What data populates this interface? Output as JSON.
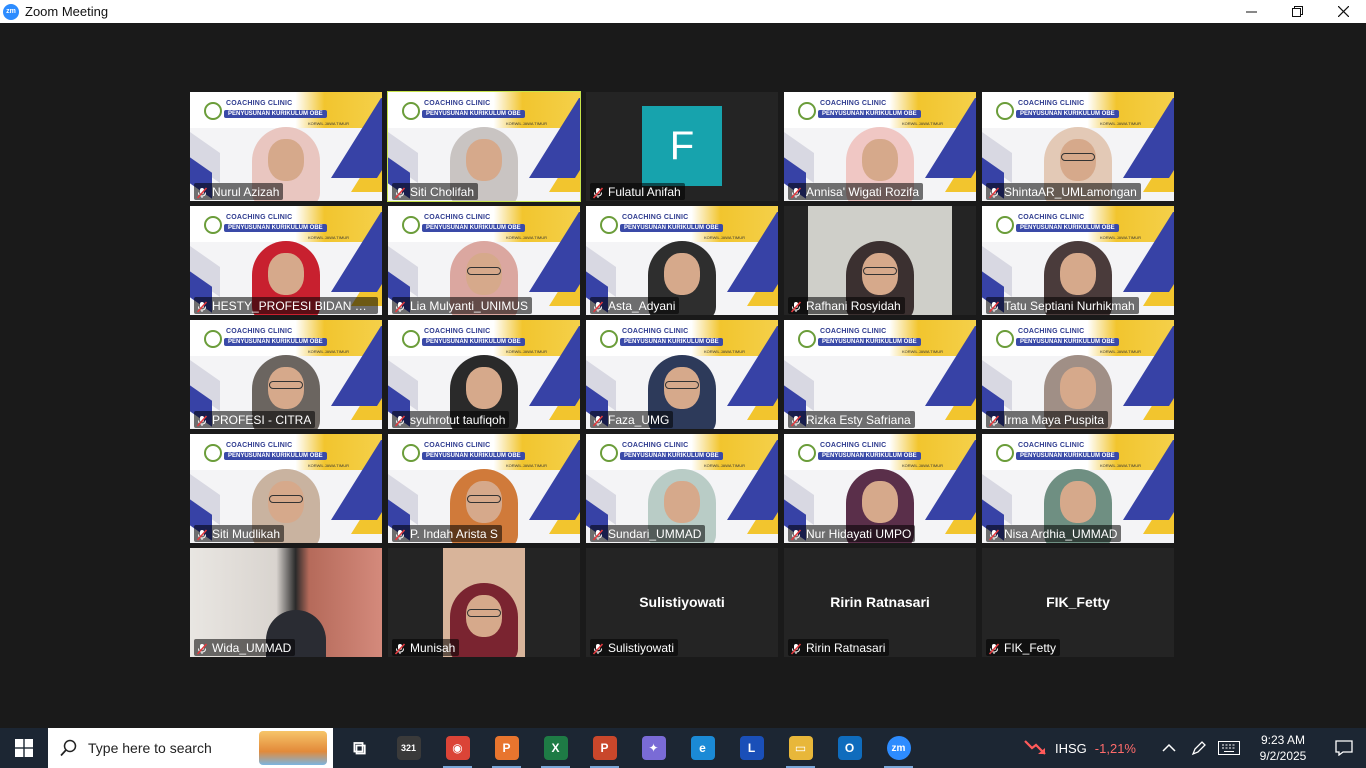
{
  "window": {
    "title": "Zoom Meeting",
    "logo_text": "zm"
  },
  "banner": {
    "title": "COACHING CLINIC",
    "subtitle": "PENYUSUNAN KURIKULUM OBE",
    "region": "KORWIL JAWA TIMUR"
  },
  "participants": [
    {
      "name": "Nurul Azizah",
      "kind": "vbg",
      "hijab": "#e9c6c0",
      "glasses": false
    },
    {
      "name": "Siti Cholifah",
      "kind": "vbg",
      "hijab": "#c9c4c2",
      "glasses": false,
      "speaking": true
    },
    {
      "name": "Fulatul Anifah",
      "kind": "avatar",
      "initial": "F"
    },
    {
      "name": "Annisa' Wigati Rozifa",
      "kind": "vbg",
      "hijab": "#f0c7c4",
      "glasses": false
    },
    {
      "name": "ShintaAR_UMLamongan",
      "kind": "vbg",
      "hijab": "#e3c9b6",
      "glasses": true
    },
    {
      "name": "HESTY_PROFESI BIDAN UM...",
      "kind": "vbg",
      "hijab": "#c8202f",
      "glasses": false
    },
    {
      "name": "Lia Mulyanti_UNIMUS",
      "kind": "vbg",
      "hijab": "#dba7a0",
      "glasses": true
    },
    {
      "name": "Asta_Adyani",
      "kind": "vbg",
      "hijab": "#2e2e2e",
      "glasses": false
    },
    {
      "name": "Rafhani Rosyidah",
      "kind": "photo",
      "bg": "#cfcfc9",
      "hijab": "#3b3030",
      "glasses": true
    },
    {
      "name": "Tatu Septiani Nurhikmah",
      "kind": "vbg",
      "hijab": "#4a3b3b",
      "glasses": false
    },
    {
      "name": "PROFESI - CITRA",
      "kind": "vbg",
      "hijab": "#6b6560",
      "glasses": true
    },
    {
      "name": "syuhrotut taufiqoh",
      "kind": "vbg",
      "hijab": "#2a2a2a",
      "glasses": false
    },
    {
      "name": "Faza_UMG",
      "kind": "vbg",
      "hijab": "#2d3a5a",
      "glasses": true
    },
    {
      "name": "Rizka Esty Safriana",
      "kind": "vbg",
      "hijab": "",
      "glasses": false,
      "empty": true
    },
    {
      "name": "Irma Maya Puspita",
      "kind": "vbg",
      "hijab": "#a08f86",
      "glasses": false
    },
    {
      "name": "Siti Mudlikah",
      "kind": "vbg",
      "hijab": "#c9b3a0",
      "glasses": true
    },
    {
      "name": "P. Indah Arista S",
      "kind": "vbg",
      "hijab": "#d07a3a",
      "glasses": true
    },
    {
      "name": "Sundari_UMMAD",
      "kind": "vbg",
      "hijab": "#b9ccc6",
      "glasses": false
    },
    {
      "name": "Nur Hidayati UMPO",
      "kind": "vbg",
      "hijab": "#5a2f4a",
      "glasses": false
    },
    {
      "name": "Nisa Ardhia_UMMAD",
      "kind": "vbg",
      "hijab": "#6f8f82",
      "glasses": false
    },
    {
      "name": "Wida_UMMAD",
      "kind": "room"
    },
    {
      "name": "Munisah",
      "kind": "portrait",
      "hijab": "#7a2430",
      "glasses": true
    },
    {
      "name": "Sulistiyowati",
      "kind": "name",
      "display": "Sulistiyowati"
    },
    {
      "name": "Ririn Ratnasari",
      "kind": "name",
      "display": "Ririn Ratnasari"
    },
    {
      "name": "FIK_Fetty",
      "kind": "name",
      "display": "FIK_Fetty"
    }
  ],
  "taskbar": {
    "search_placeholder": "Type here to search",
    "apps": [
      {
        "icon": "task-view-icon",
        "color": "transparent",
        "glyph": "⧉"
      },
      {
        "icon": "calendar-app-icon",
        "color": "#3a3a3a",
        "glyph": "321"
      },
      {
        "icon": "chrome-icon",
        "color": "#db4437",
        "glyph": "◉",
        "active": true
      },
      {
        "icon": "pdf-app-icon",
        "color": "#e8752e",
        "glyph": "P",
        "active": true
      },
      {
        "icon": "excel-icon",
        "color": "#1e7b45",
        "glyph": "X",
        "active": true
      },
      {
        "icon": "powerpoint-icon",
        "color": "#c9472b",
        "glyph": "P",
        "active": true
      },
      {
        "icon": "copilot-icon",
        "color": "#7a6bd6",
        "glyph": "✦"
      },
      {
        "icon": "edge-icon",
        "color": "#1b8ad6",
        "glyph": "e"
      },
      {
        "icon": "l-app-icon",
        "color": "#1a4fb8",
        "glyph": "L"
      },
      {
        "icon": "file-explorer-icon",
        "color": "#e8b73a",
        "glyph": "▭",
        "active": true
      },
      {
        "icon": "outlook-icon",
        "color": "#0f6cbd",
        "glyph": "O"
      },
      {
        "icon": "zoom-icon",
        "color": "#2d8cff",
        "glyph": "zm",
        "active": true
      }
    ],
    "stock_name": "IHSG",
    "stock_value": "-1,21%",
    "time": "9:23 AM",
    "date": "9/2/2025"
  }
}
